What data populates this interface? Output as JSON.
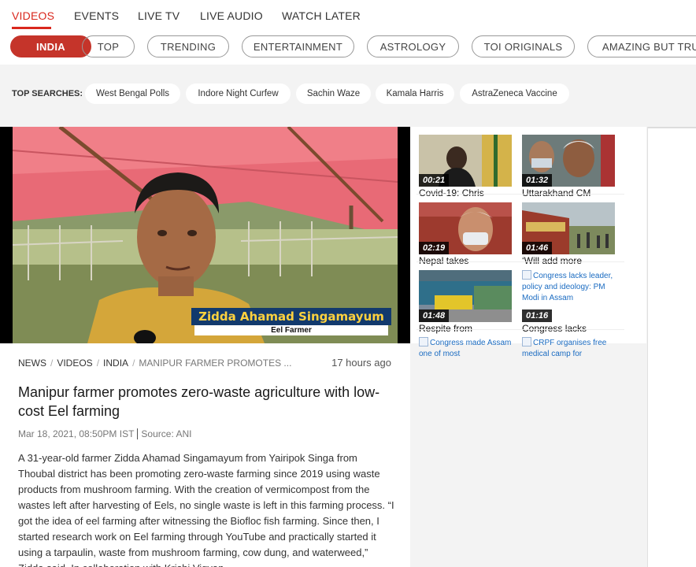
{
  "topnav": {
    "items": [
      "VIDEOS",
      "EVENTS",
      "LIVE TV",
      "LIVE AUDIO",
      "WATCH LATER"
    ],
    "active_index": 0
  },
  "categories": {
    "items": [
      "INDIA",
      "TOP",
      "TRENDING",
      "ENTERTAINMENT",
      "ASTROLOGY",
      "TOI ORIGINALS",
      "AMAZING BUT TRUE"
    ],
    "active_index": 0
  },
  "top_searches": {
    "label": "TOP SEARCHES:",
    "tags": [
      "West Bengal Polls",
      "Indore Night Curfew",
      "Sachin Waze",
      "Kamala Harris",
      "AstraZeneca Vaccine"
    ]
  },
  "video": {
    "lower_third_name": "Zidda Ahamad Singamayum",
    "lower_third_title": "Eel Farmer"
  },
  "article": {
    "breadcrumb": [
      "NEWS",
      "VIDEOS",
      "INDIA",
      "MANIPUR FARMER PROMOTES ..."
    ],
    "time_ago": "17 hours ago",
    "headline": "Manipur farmer promotes zero-waste agriculture with low-cost Eel farming",
    "date": "Mar 18, 2021, 08:50PM IST",
    "source": "Source: ANI",
    "body": "A 31-year-old farmer Zidda Ahamad Singamayum from Yairipok Singa from Thoubal district has been promoting zero-waste farming since 2019 using waste products from mushroom farming. With the creation of vermicompost from the wastes left after harvesting of Eels, no single waste is left in this farming process. “I got the idea of eel farming after witnessing the Biofloc fish farming. Since then, I started research work on Eel farming through YouTube and practically started it using a tarpaulin, waste from mushroom farming, cow dung, and waterweed,” Zidda said. In collaboration with Krishi Vigyan"
  },
  "related": [
    {
      "duration": "00:21",
      "title": "Covid-19: Chris"
    },
    {
      "duration": "01:32",
      "title": "Uttarakhand CM"
    },
    {
      "duration": "02:19",
      "title": "Nepal takes"
    },
    {
      "duration": "01:46",
      "title": "‘Will add more"
    },
    {
      "duration": "01:48",
      "title": "Respite from"
    },
    {
      "duration": "01:16",
      "title": "Congress lacks",
      "alt": "Congress lacks leader, policy and ideology: PM Modi in Assam"
    },
    {
      "alt": "Congress made Assam one of most"
    },
    {
      "alt": "CRPF organises free medical camp for"
    }
  ],
  "colors": {
    "accent": "#d9271d",
    "pill_active": "#c5342a",
    "link": "#1a6bc1",
    "lower_third_bg": "#123a6d",
    "lower_third_text": "#ffd23e"
  }
}
